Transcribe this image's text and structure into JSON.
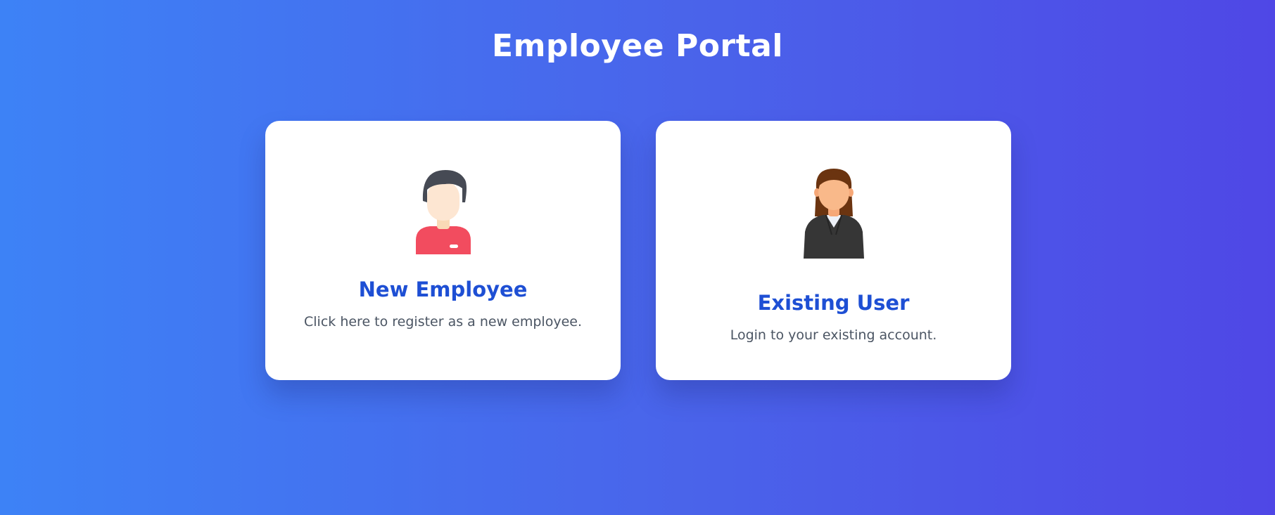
{
  "page": {
    "title": "Employee Portal"
  },
  "cards": [
    {
      "title": "New Employee",
      "description": "Click here to register as a new employee.",
      "icon": "male-employee-avatar-icon"
    },
    {
      "title": "Existing User",
      "description": "Login to your existing account.",
      "icon": "female-employee-avatar-icon"
    }
  ],
  "colors": {
    "background_start": "#3d82f6",
    "background_end": "#4f47e6",
    "card_background": "#ffffff",
    "card_title": "#1e4fd4",
    "card_description": "#4b5563"
  }
}
